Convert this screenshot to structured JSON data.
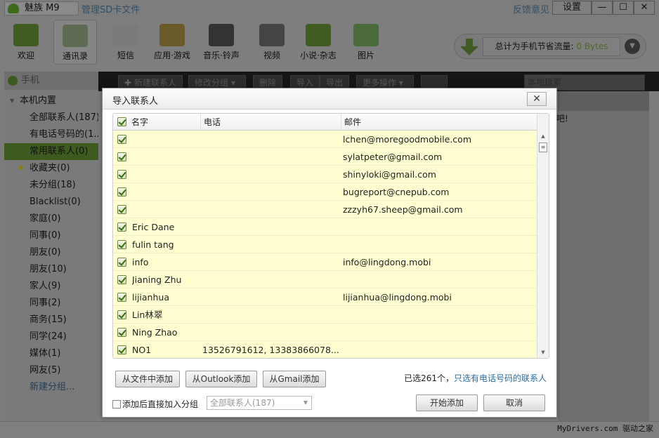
{
  "titlebar": {
    "app_name": "魅族 M9",
    "sd_link": "管理SD卡文件",
    "feedback": "反馈意见",
    "settings": "设置",
    "minimize": "—",
    "maximize": "☐",
    "close": "✕"
  },
  "toolbar": {
    "items": [
      {
        "label": "欢迎",
        "icon": "peas-icon"
      },
      {
        "label": "通讯录",
        "icon": "contacts-card-icon"
      },
      {
        "label": "短信",
        "icon": "message-icon"
      },
      {
        "label": "应用·游戏",
        "icon": "app-box-icon"
      },
      {
        "label": "音乐·铃声",
        "icon": "headphones-icon"
      },
      {
        "label": "视频",
        "icon": "clapper-icon"
      },
      {
        "label": "小说·杂志",
        "icon": "book-icon"
      },
      {
        "label": "图片",
        "icon": "picture-icon"
      }
    ]
  },
  "traffic": {
    "label": "总计为手机节省流量: ",
    "value": "0 Bytes"
  },
  "actionbar": {
    "new_contact": "新建联系人",
    "edit_group": "修改分组",
    "delete": "删除",
    "import": "导入",
    "export": "导出",
    "more": "更多操作",
    "search_placeholder": "本地搜索"
  },
  "sidebar": {
    "header": "手机",
    "group": "本机内置",
    "items": [
      {
        "label": "全部联系人(187)"
      },
      {
        "label": "有电话号码的(1..."
      },
      {
        "label": "常用联系人(0)",
        "selected": true
      },
      {
        "label": "收藏夹(0)",
        "star": true
      },
      {
        "label": "未分组(18)"
      },
      {
        "label": "Blacklist(0)"
      },
      {
        "label": "家庭(0)"
      },
      {
        "label": "同事(0)"
      },
      {
        "label": "朋友(0)"
      },
      {
        "label": "朋友(10)"
      },
      {
        "label": "家人(9)"
      },
      {
        "label": "同事(2)"
      },
      {
        "label": "商务(15)"
      },
      {
        "label": "同学(24)"
      },
      {
        "label": "媒体(1)"
      },
      {
        "label": "网友(5)"
      },
      {
        "label": "新建分组..."
      }
    ]
  },
  "right_hint": "吧!",
  "watermark": "MyDrivers.com 驱动之家",
  "dialog": {
    "title": "导入联系人",
    "close": "✕",
    "columns": [
      "名字",
      "电话",
      "邮件"
    ],
    "rows": [
      {
        "name": "",
        "phone": "",
        "email": "lchen@moregoodmobile.com"
      },
      {
        "name": "",
        "phone": "",
        "email": "sylatpeter@gmail.com"
      },
      {
        "name": "",
        "phone": "",
        "email": "shinyloki@gmail.com"
      },
      {
        "name": "",
        "phone": "",
        "email": "bugreport@cnepub.com"
      },
      {
        "name": "",
        "phone": "",
        "email": "zzzyh67.sheep@gmail.com"
      },
      {
        "name": "Eric Dane",
        "phone": "",
        "email": ""
      },
      {
        "name": "fulin tang",
        "phone": "",
        "email": ""
      },
      {
        "name": "info",
        "phone": "",
        "email": "info@lingdong.mobi"
      },
      {
        "name": "Jianing Zhu",
        "phone": "",
        "email": ""
      },
      {
        "name": "lijianhua",
        "phone": "",
        "email": "lijianhua@lingdong.mobi"
      },
      {
        "name": "Lin林翠",
        "phone": "",
        "email": ""
      },
      {
        "name": "Ning Zhao",
        "phone": "",
        "email": ""
      },
      {
        "name": "NO1",
        "phone": "13526791612, 13383866078...",
        "email": ""
      }
    ],
    "add_from_file": "从文件中添加",
    "add_from_outlook": "从Outlook添加",
    "add_from_gmail": "从Gmail添加",
    "selected_text": "已选261个，",
    "only_phone_link": "只选有电话号码的联系人",
    "auto_group_label": "添加后直接加入分组",
    "group_value": "全部联系人(187)",
    "start": "开始添加",
    "cancel": "取消"
  }
}
